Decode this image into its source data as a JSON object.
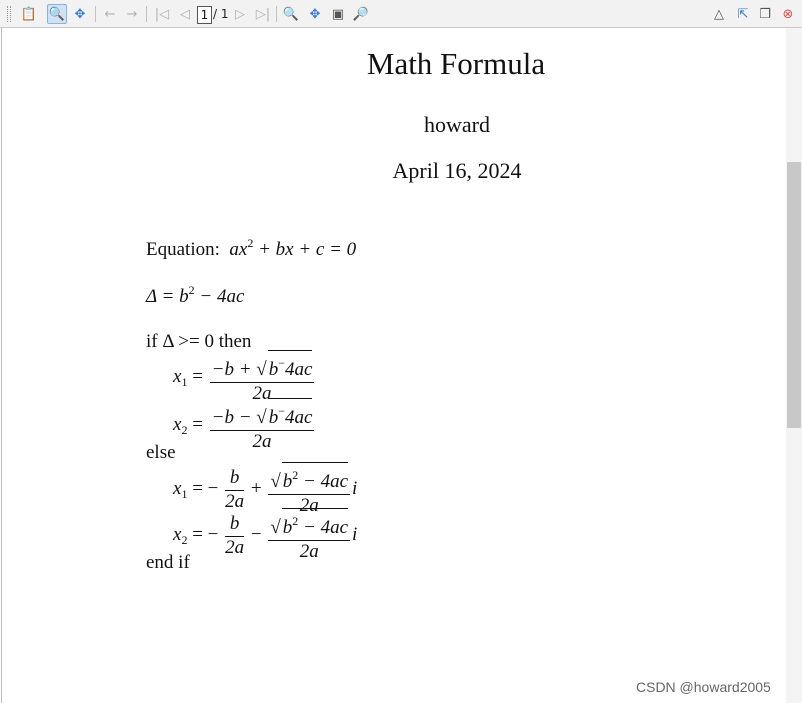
{
  "toolbar": {
    "page_current": "1",
    "page_total": "/ 1",
    "icons": [
      "grip-icon",
      "clipboard-icon",
      "zoom-select-icon",
      "pan-icon",
      "back-arrow-icon",
      "forward-arrow-icon",
      "first-page-icon",
      "prev-page-icon",
      "next-page-icon",
      "last-page-icon",
      "zoom-icon",
      "fit-icon",
      "page-settings-icon",
      "find-icon",
      "collapse-icon",
      "dock-icon",
      "maximize-icon",
      "close-icon"
    ]
  },
  "document": {
    "title": "Math Formula",
    "author": "howard",
    "date": "April 16, 2024",
    "equation_label": "Equation:",
    "equation": "ax² + bx + c = 0",
    "delta_def": "Δ = b² − 4ac",
    "if_line": "if Δ >= 0 then",
    "x1": "x",
    "sub1": "1",
    "sub2": "2",
    "else": "else",
    "end_if": "end if",
    "two_a": "2a",
    "minus_b": "−b",
    "b": "b",
    "sqrt_content_real": "b−4ac",
    "sqrt_content_complex": "b² − 4ac",
    "imag_unit": "i"
  },
  "watermark": "CSDN @howard2005",
  "colors": {
    "toolbar_bg": "#f2f2f2",
    "active_btn": "#cfe1f5",
    "close_red": "#d9534f"
  }
}
